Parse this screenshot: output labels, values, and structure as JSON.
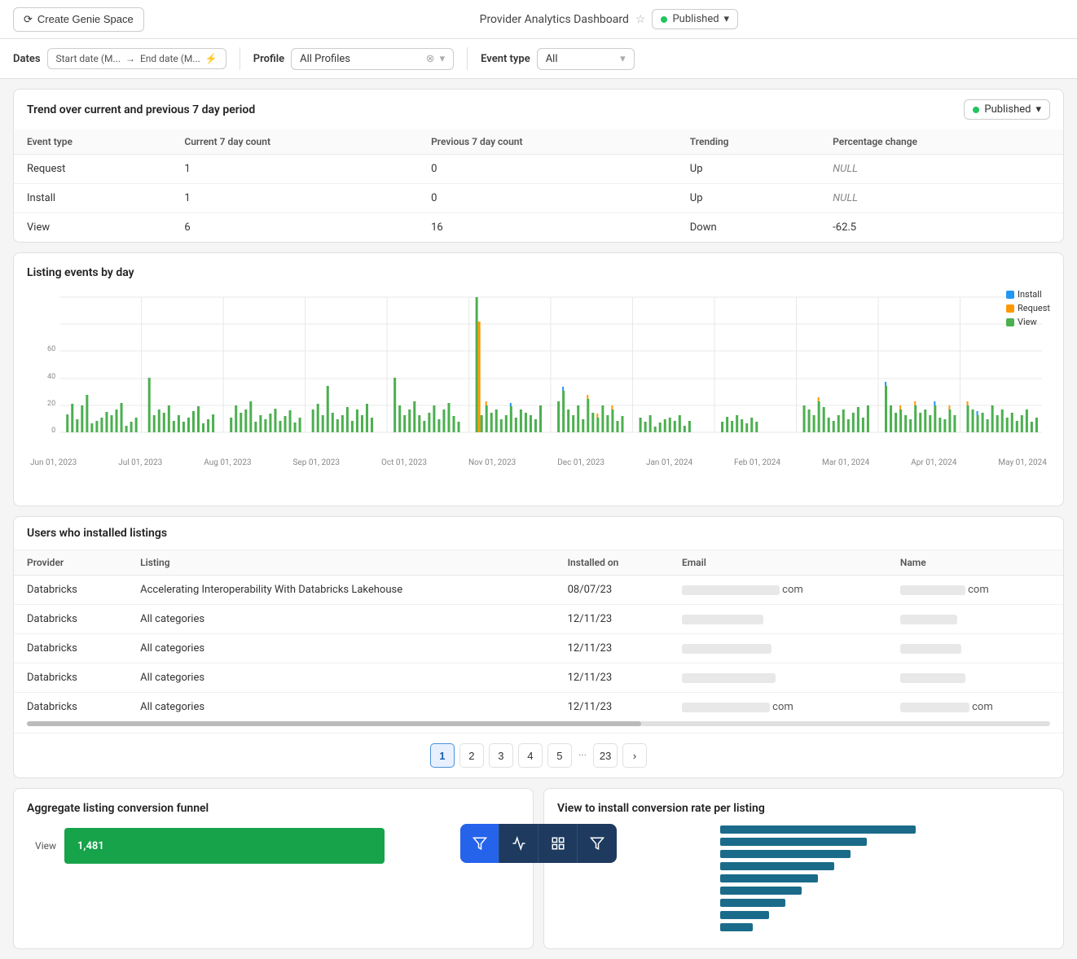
{
  "header": {
    "create_btn": "Create Genie Space",
    "title": "Provider Analytics Dashboard",
    "published_label": "Published"
  },
  "filters": {
    "dates_label": "Dates",
    "start_date": "Start date (M...",
    "end_date": "End date (M...",
    "profile_label": "Profile",
    "profile_value": "All Profiles",
    "event_type_label": "Event type",
    "event_type_value": "All"
  },
  "trend_section": {
    "title": "Trend over current and previous 7 day period",
    "published_label": "Published",
    "columns": [
      "Event type",
      "Current 7 day count",
      "Previous 7 day count",
      "Trending",
      "Percentage change"
    ],
    "rows": [
      {
        "event_type": "Request",
        "current": "1",
        "previous": "0",
        "trending": "Up",
        "pct_change": "NULL",
        "null": true
      },
      {
        "event_type": "Install",
        "current": "1",
        "previous": "0",
        "trending": "Up",
        "pct_change": "NULL",
        "null": true
      },
      {
        "event_type": "View",
        "current": "6",
        "previous": "16",
        "trending": "Down",
        "pct_change": "-62.5",
        "null": false
      }
    ]
  },
  "chart_section": {
    "title": "Listing events by day",
    "legend": [
      {
        "label": "Install",
        "color": "#2196f3"
      },
      {
        "label": "Request",
        "color": "#ff9800"
      },
      {
        "label": "View",
        "color": "#4caf50"
      }
    ],
    "x_labels": [
      "Jun 01, 2023",
      "Jul 01, 2023",
      "Aug 01, 2023",
      "Sep 01, 2023",
      "Oct 01, 2023",
      "Nov 01, 2023",
      "Dec 01, 2023",
      "Jan 01, 2024",
      "Feb 01, 2024",
      "Mar 01, 2024",
      "Apr 01, 2024",
      "May 01, 2024"
    ],
    "y_labels": [
      "0",
      "20",
      "40",
      "60"
    ]
  },
  "users_section": {
    "title": "Users who installed listings",
    "columns": [
      "Provider",
      "Listing",
      "Installed on",
      "Email",
      "Name"
    ],
    "rows": [
      {
        "provider": "Databricks",
        "listing": "Accelerating Interoperability With Databricks Lakehouse",
        "installed_on": "08/07/23",
        "email": "blurred",
        "name": "blurred_com"
      },
      {
        "provider": "Databricks",
        "listing": "All categories",
        "installed_on": "12/11/23",
        "email": "blurred",
        "name": "blurred"
      },
      {
        "provider": "Databricks",
        "listing": "All categories",
        "installed_on": "12/11/23",
        "email": "blurred",
        "name": "blurred"
      },
      {
        "provider": "Databricks",
        "listing": "All categories",
        "installed_on": "12/11/23",
        "email": "blurred",
        "name": "blurred"
      },
      {
        "provider": "Databricks",
        "listing": "All categories",
        "installed_on": "12/11/23",
        "email": "blurred",
        "name": "blurred_com"
      }
    ]
  },
  "pagination": {
    "pages": [
      "1",
      "2",
      "3",
      "4",
      "5",
      "...",
      "23"
    ],
    "active": "1",
    "next_label": "›"
  },
  "funnel_section": {
    "title": "Aggregate listing conversion funnel",
    "rows": [
      {
        "label": "View",
        "value": "1,481",
        "width": 65
      }
    ]
  },
  "rate_section": {
    "title": "View to install conversion rate per listing"
  },
  "toolbar": {
    "buttons": [
      "filter",
      "chart",
      "grid",
      "filter2"
    ]
  }
}
